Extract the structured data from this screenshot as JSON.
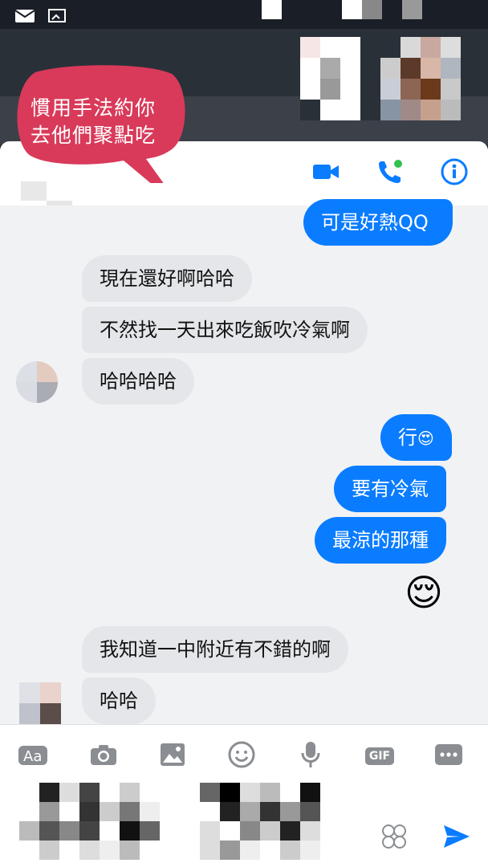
{
  "overlay": {
    "speech_bubble_lines": [
      "慣用手法約你",
      "去他們聚點吃"
    ],
    "speech_color": "#d93a5a"
  },
  "header": {
    "video_call_icon": "video-camera-icon",
    "voice_call_icon": "phone-icon",
    "info_icon": "info-icon",
    "accent": "#0a7cff"
  },
  "messages": [
    {
      "side": "out",
      "text": "可是好熱QQ"
    },
    {
      "side": "in",
      "text": "現在還好啊哈哈"
    },
    {
      "side": "in",
      "text": "不然找一天出來吃飯吹冷氣啊"
    },
    {
      "side": "in",
      "text": "哈哈哈哈"
    },
    {
      "side": "out",
      "text": "行",
      "emoji": "😍"
    },
    {
      "side": "out",
      "text": "要有冷氣"
    },
    {
      "side": "out",
      "text": "最涼的那種"
    },
    {
      "side": "out",
      "emoji_only": "😌"
    },
    {
      "side": "in",
      "text": "我知道一中附近有不錯的啊"
    },
    {
      "side": "in",
      "text": "哈哈"
    }
  ],
  "composer": {
    "tools": [
      "text-format-icon",
      "camera-icon",
      "image-icon",
      "emoji-icon",
      "microphone-icon",
      "gif-icon",
      "more-icon"
    ],
    "gif_label": "GIF",
    "send_icon": "send-icon"
  }
}
